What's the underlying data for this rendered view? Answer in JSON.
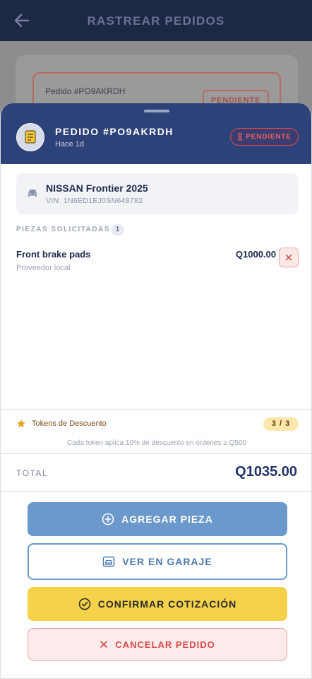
{
  "header": {
    "title": "RASTREAR PEDIDOS",
    "back_icon": "arrow-left-icon"
  },
  "background_card": {
    "order_label": "Pedido #PO9AKRDH",
    "status": "PENDIENTE"
  },
  "sheet": {
    "order_title": "PEDIDO #PO9AKRDH",
    "time_ago": "Hace 1d",
    "status": "PENDIENTE",
    "status_icon": "hourglass-icon",
    "order_icon": "receipt-icon"
  },
  "vehicle": {
    "name": "NISSAN Frontier 2025",
    "vin": "VIN: 1N6ED1EJ0SN648782",
    "icon": "car-icon"
  },
  "parts": {
    "section_label": "PIEZAS SOLICITADAS",
    "count": "1",
    "items": [
      {
        "name": "Front brake pads",
        "vendor": "Proveedor local",
        "price": "Q1000.00"
      }
    ]
  },
  "tokens": {
    "label": "Tokens de Descuento",
    "count": "3 / 3",
    "note": "Cada token aplica 10% de descuento en órdenes ≥ Q500"
  },
  "total": {
    "label": "TOTAL",
    "value": "Q1035.00"
  },
  "actions": {
    "add_part": "AGREGAR PIEZA",
    "view_garage": "VER EN GARAJE",
    "confirm_quote": "CONFIRMAR COTIZACIÓN",
    "cancel_order": "CANCELAR PEDIDO"
  },
  "colors": {
    "header_dark": "#1c2844",
    "sheet_header": "#2d4279",
    "accent_blue": "#6b99cb",
    "accent_yellow": "#f6d24b",
    "danger": "#d94a4a"
  }
}
